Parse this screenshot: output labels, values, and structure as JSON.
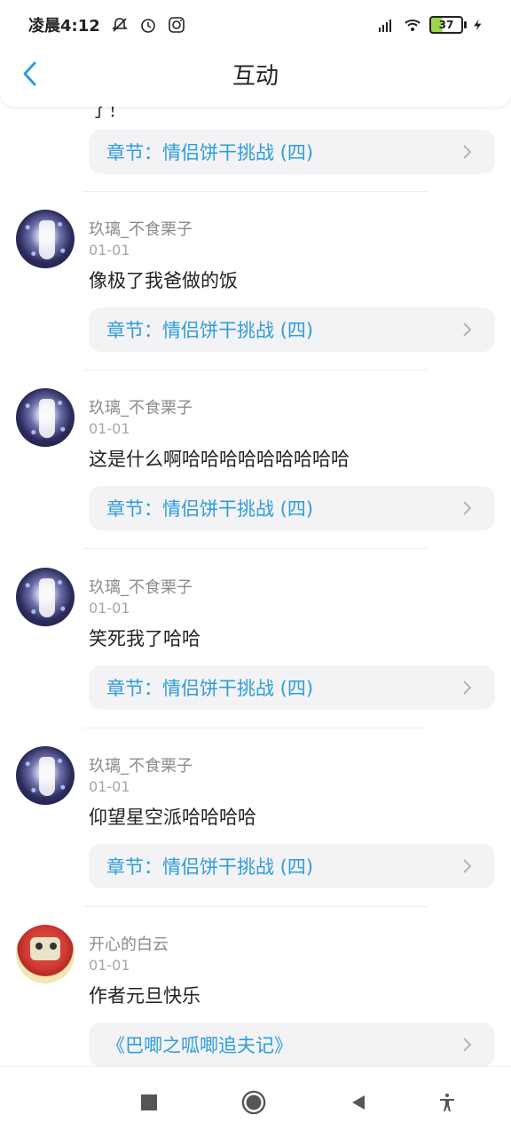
{
  "status_bar": {
    "time": "凌晨4:12",
    "battery": "37"
  },
  "header": {
    "title": "互动"
  },
  "list": {
    "truncated_text": "了！",
    "first_chapter": "章节：情侣饼干挑战 (四)",
    "items": [
      {
        "username": "玖璃_不食栗子",
        "date": "01-01",
        "comment": "像极了我爸做的饭",
        "link": "章节：情侣饼干挑战 (四)"
      },
      {
        "username": "玖璃_不食栗子",
        "date": "01-01",
        "comment": "这是什么啊哈哈哈哈哈哈哈哈哈",
        "link": "章节：情侣饼干挑战 (四)"
      },
      {
        "username": "玖璃_不食栗子",
        "date": "01-01",
        "comment": "笑死我了哈哈",
        "link": "章节：情侣饼干挑战 (四)"
      },
      {
        "username": "玖璃_不食栗子",
        "date": "01-01",
        "comment": "仰望星空派哈哈哈哈",
        "link": "章节：情侣饼干挑战 (四)"
      },
      {
        "username": "开心的白云",
        "date": "01-01",
        "comment": "作者元旦快乐",
        "link": "《巴唧之呱唧追夫记》"
      }
    ]
  },
  "colors": {
    "accent": "#2d9cdb"
  },
  "icons": {
    "back": "chevron-left-icon",
    "chevron": "chevron-right-icon",
    "nav_square": "square-icon",
    "nav_home": "circle-icon",
    "nav_back": "triangle-back-icon",
    "nav_access": "accessibility-icon"
  }
}
